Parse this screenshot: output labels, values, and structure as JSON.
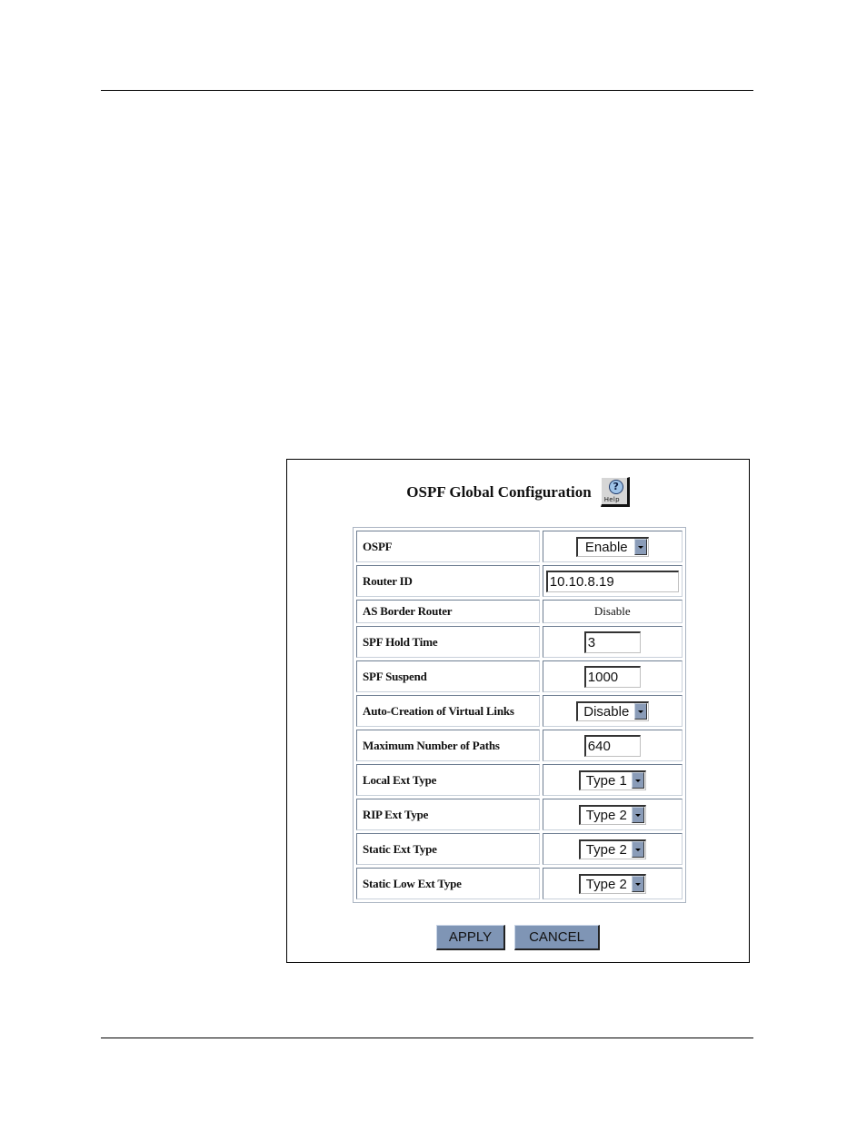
{
  "panel": {
    "title": "OSPF Global Configuration",
    "help": {
      "icon": "question-mark-icon",
      "label": "Help"
    }
  },
  "rows": [
    {
      "label": "OSPF",
      "type": "select",
      "value": "Enable"
    },
    {
      "label": "Router ID",
      "type": "input",
      "value": "10.10.8.19"
    },
    {
      "label": "AS Border Router",
      "type": "static",
      "value": "Disable"
    },
    {
      "label": "SPF Hold Time",
      "type": "input",
      "value": "3"
    },
    {
      "label": "SPF Suspend",
      "type": "input",
      "value": "1000"
    },
    {
      "label": "Auto-Creation of Virtual Links",
      "type": "select",
      "value": "Disable"
    },
    {
      "label": "Maximum Number of Paths",
      "type": "input",
      "value": "640"
    },
    {
      "label": "Local Ext Type",
      "type": "select",
      "value": "Type 1"
    },
    {
      "label": "RIP Ext Type",
      "type": "select",
      "value": "Type 2"
    },
    {
      "label": "Static Ext Type",
      "type": "select",
      "value": "Type 2"
    },
    {
      "label": "Static Low Ext Type",
      "type": "select",
      "value": "Type 2"
    }
  ],
  "buttons": {
    "apply": "APPLY",
    "cancel": "CANCEL"
  },
  "colors": {
    "button_bg": "#7f95b5",
    "dropdown_arrow": "#8a9cb8",
    "table_border": "#6e7e92"
  }
}
